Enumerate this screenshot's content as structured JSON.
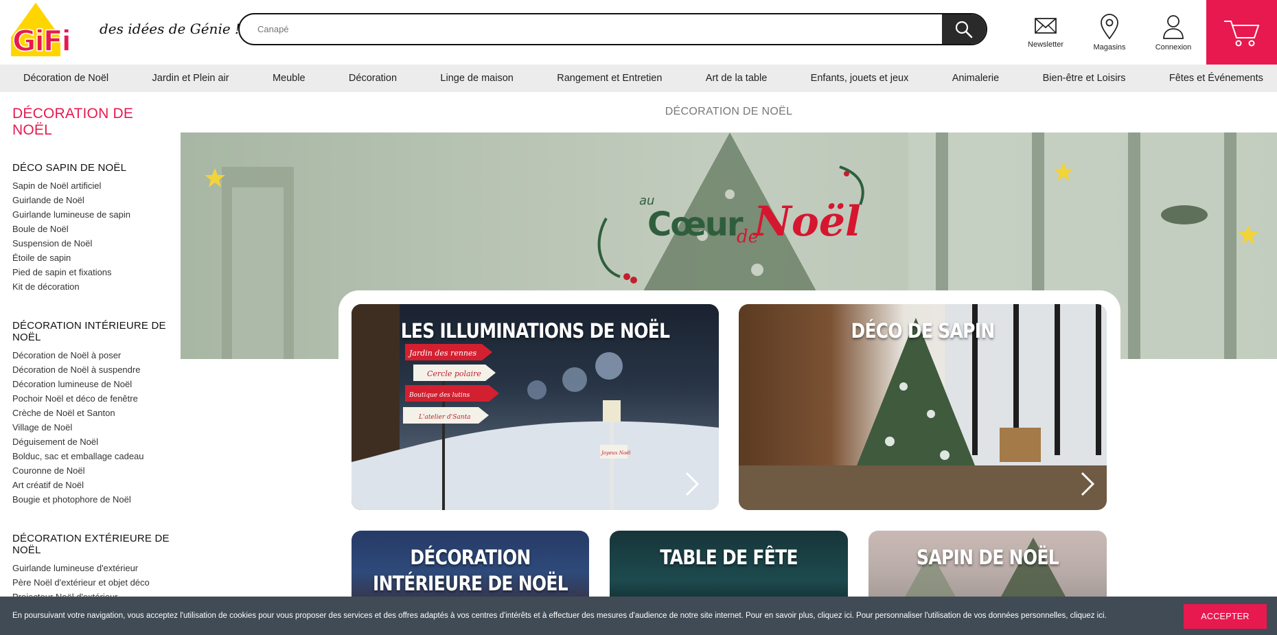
{
  "header": {
    "logo_text": "GiFi",
    "tagline": "des idées de Génie !",
    "search": {
      "value": "",
      "placeholder": "Canapé"
    },
    "icons": [
      {
        "name": "newsletter",
        "label": "Newsletter"
      },
      {
        "name": "magasins",
        "label": "Magasins"
      },
      {
        "name": "connexion",
        "label": "Connexion"
      }
    ]
  },
  "nav": {
    "items": [
      "Décoration de Noël",
      "Jardin et Plein air",
      "Meuble",
      "Décoration",
      "Linge de maison",
      "Rangement et Entretien",
      "Art de la table",
      "Enfants, jouets et jeux",
      "Animalerie",
      "Bien-être et Loisirs",
      "Fêtes et Événements"
    ]
  },
  "sidebar": {
    "title": "DÉCORATION DE NOËL",
    "sections": [
      {
        "heading": "DÉCO SAPIN DE NOËL",
        "links": [
          "Sapin de Noël artificiel",
          "Guirlande de Noël",
          "Guirlande lumineuse de sapin",
          "Boule de Noël",
          "Suspension de Noël",
          "Étoile de sapin",
          "Pied de sapin et fixations",
          "Kit de décoration"
        ]
      },
      {
        "heading": "DÉCORATION INTÉRIEURE DE NOËL",
        "links": [
          "Décoration de Noël à poser",
          "Décoration de Noël à suspendre",
          "Décoration lumineuse de Noël",
          "Pochoir Noël et déco de fenêtre",
          "Crèche de Noël et Santon",
          "Village de Noël",
          "Déguisement de Noël",
          "Bolduc, sac et emballage cadeau",
          "Couronne de Noël",
          "Art créatif de Noël",
          "Bougie et photophore de Noël"
        ]
      },
      {
        "heading": "DÉCORATION EXTÉRIEURE DE NOËL",
        "links": [
          "Guirlande lumineuse d'extérieur",
          "Père Noël d'extérieur et objet déco",
          "Projecteur Noël d'extérieur"
        ]
      }
    ]
  },
  "main": {
    "title": "DÉCORATION DE NOËL",
    "banner": {
      "word_au": "au",
      "word_coeur": "Cœur",
      "word_de": "de",
      "word_noel": "Noël"
    },
    "tiles": [
      {
        "title": "LES ILLUMINATIONS DE NOËL",
        "signs": [
          "Jardin des rennes",
          "Cercle polaire",
          "Boutique des lutins",
          "L'atelier d'Santa"
        ],
        "lantern_sign": "Joyeux Noël"
      },
      {
        "title": "DÉCO DE SAPIN"
      },
      {
        "title_line1": "DÉCORATION",
        "title_line2": "INTÉRIEURE DE NOËL"
      },
      {
        "title": "TABLE DE FÊTE"
      },
      {
        "title": "SAPIN DE NOËL"
      }
    ]
  },
  "cookie": {
    "text": "En poursuivant votre navigation, vous acceptez l'utilisation de cookies pour vous proposer des services et des offres adaptés à vos centres d'intérêts et à effectuer des mesures d'audience de notre site internet. Pour en savoir plus, cliquez ici. Pour personnaliser l'utilisation de vos données personnelles, cliquez ici.",
    "button": "ACCEPTER"
  },
  "colors": {
    "brand_red": "#e8194f",
    "logo_yellow": "#ffd500",
    "nav_bg": "#ececec",
    "cookie_bg": "#414b55",
    "banner_green": "#2f5e3d"
  }
}
